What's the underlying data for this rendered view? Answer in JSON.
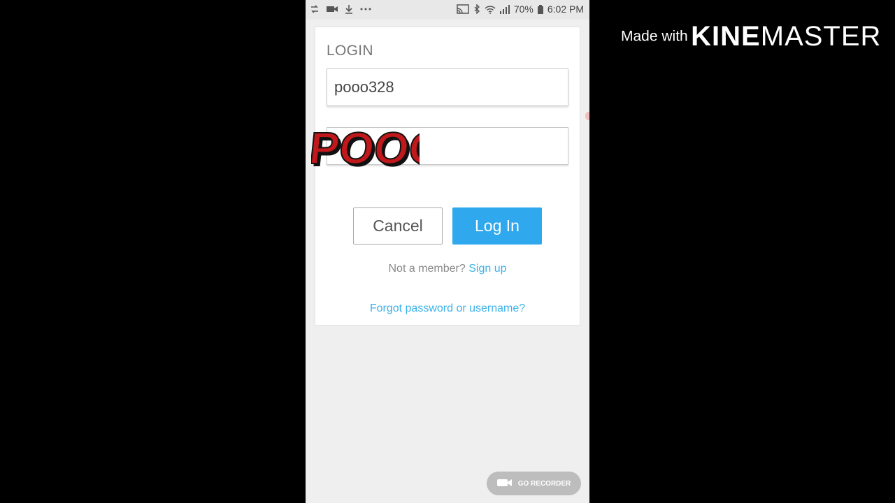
{
  "status_bar": {
    "battery": "70%",
    "time": "6:02 PM",
    "left_icons": [
      "swap-icon",
      "video-camera-icon",
      "download-icon",
      "more-dots-icon"
    ],
    "right_icons": [
      "cast-icon",
      "bluetooth-icon",
      "wifi-icon",
      "signal-icon",
      "battery-icon"
    ]
  },
  "login": {
    "title": "LOGIN",
    "username_value": "pooo328",
    "password_value": "",
    "cancel_label": "Cancel",
    "login_label": "Log In",
    "not_member_text": "Not a member?",
    "signup_label": "Sign up",
    "forgot_label": "Forgot password or username?"
  },
  "overlay": {
    "sticker_text": "POOO",
    "watermark_made": "Made with",
    "watermark_kine": "KINE",
    "watermark_master": "MASTER",
    "recorder_label": "GO RECORDER"
  },
  "colors": {
    "accent_blue": "#2fa8ee",
    "link_blue": "#3cb2ea",
    "sticker_red": "#c0181b"
  }
}
